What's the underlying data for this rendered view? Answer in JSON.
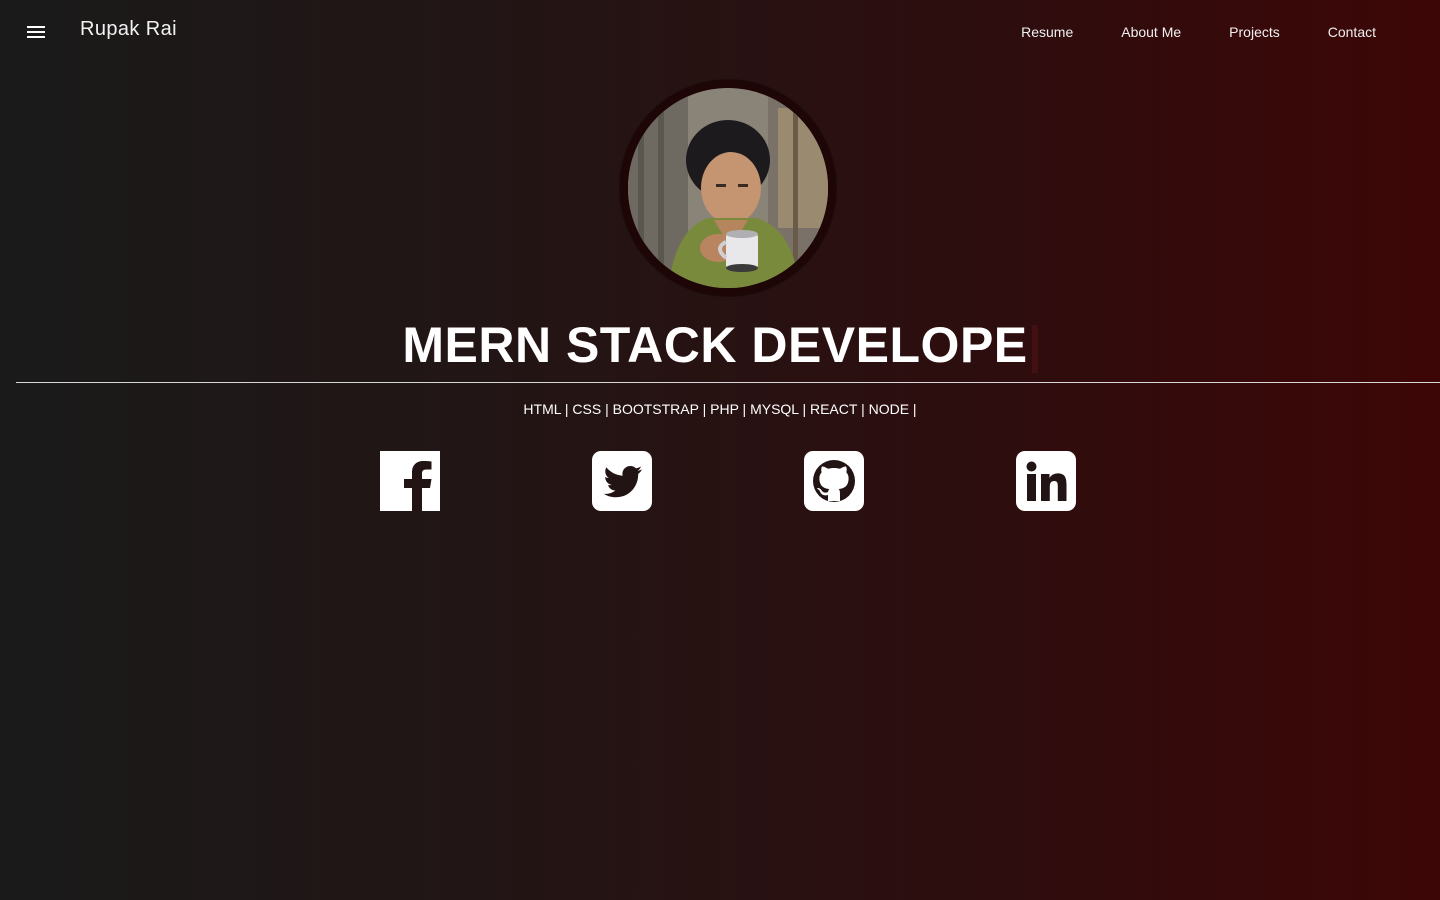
{
  "nav": {
    "brand": "Rupak Rai",
    "menu_icon": "hamburger-menu-icon",
    "links": [
      {
        "label": "Resume"
      },
      {
        "label": "About Me"
      },
      {
        "label": "Projects"
      },
      {
        "label": "Contact"
      }
    ]
  },
  "hero": {
    "headline": "MERN STACK DEVELOPE",
    "skills": "HTML | CSS | BOOTSTRAP | PHP | MYSQL | REACT | NODE |"
  },
  "social": [
    {
      "icon": "facebook-icon"
    },
    {
      "icon": "twitter-icon"
    },
    {
      "icon": "github-icon"
    },
    {
      "icon": "linkedin-icon"
    }
  ],
  "colors": {
    "background_start": "#1a1a1a",
    "background_end": "#3d0606",
    "text": "#ffffff",
    "icon_fill": "#ffffff"
  }
}
